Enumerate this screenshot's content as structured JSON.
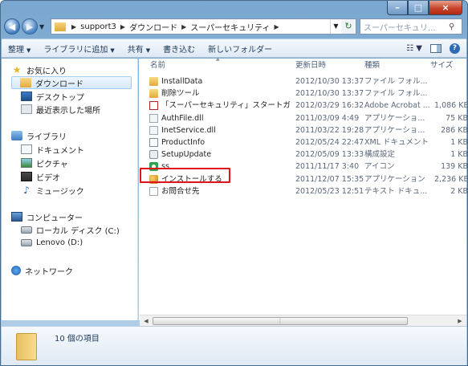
{
  "window": {
    "caption": {
      "minimize": "–",
      "maximize": "□",
      "close": "×"
    }
  },
  "address": {
    "crumbs": [
      "support3",
      "ダウンロード",
      "スーパーセキュリティ"
    ],
    "search_placeholder": "スーパーセキュリ..."
  },
  "toolbar": {
    "organize": "整理",
    "add_to_library": "ライブラリに追加",
    "share": "共有",
    "burn": "書き込む",
    "new_folder": "新しいフォルダー"
  },
  "sidebar": {
    "favorites": {
      "label": "お気に入り",
      "items": [
        "ダウンロード",
        "デスクトップ",
        "最近表示した場所"
      ]
    },
    "libraries": {
      "label": "ライブラリ",
      "items": [
        "ドキュメント",
        "ピクチャ",
        "ビデオ",
        "ミュージック"
      ]
    },
    "computer": {
      "label": "コンピューター",
      "items": [
        "ローカル ディスク (C:)",
        "Lenovo (D:)"
      ]
    },
    "network": {
      "label": "ネットワーク"
    }
  },
  "columns": {
    "name": "名前",
    "date": "更新日時",
    "type": "種類",
    "size": "サイズ"
  },
  "files": [
    {
      "name": "InstallData",
      "date": "2012/10/30 13:37",
      "type": "ファイル フォル...",
      "size": "",
      "icon": "folder"
    },
    {
      "name": "削除ツール",
      "date": "2012/10/30 13:37",
      "type": "ファイル フォル...",
      "size": "",
      "icon": "folder"
    },
    {
      "name": "「スーパーセキュリティ」スタートガ...",
      "date": "2012/03/29 16:32",
      "type": "Adobe Acrobat ...",
      "size": "1,086 KB",
      "icon": "pdf"
    },
    {
      "name": "AuthFile.dll",
      "date": "2011/03/09 4:49",
      "type": "アプリケーショ...",
      "size": "75 KB",
      "icon": "dll"
    },
    {
      "name": "InetService.dll",
      "date": "2011/03/22 19:28",
      "type": "アプリケーショ...",
      "size": "286 KB",
      "icon": "dll"
    },
    {
      "name": "ProductInfo",
      "date": "2012/05/24 22:47",
      "type": "XML ドキュメント",
      "size": "1 KB",
      "icon": "xml"
    },
    {
      "name": "SetupUpdate",
      "date": "2012/05/09 13:33",
      "type": "構成設定",
      "size": "1 KB",
      "icon": "setup"
    },
    {
      "name": "ss",
      "date": "2011/11/17 3:40",
      "type": "アイコン",
      "size": "139 KB",
      "icon": "ss"
    },
    {
      "name": "インストールする",
      "date": "2011/12/07 15:35",
      "type": "アプリケーション",
      "size": "2,236 KB",
      "icon": "inst"
    },
    {
      "name": "お問合せ先",
      "date": "2012/05/23 12:51",
      "type": "テキスト ドキュ...",
      "size": "2 KB",
      "icon": "txt"
    }
  ],
  "status": {
    "count": "10 個の項目"
  },
  "colors": {
    "highlight": "#e0141a",
    "selected_bg": "#d6e9fa"
  }
}
